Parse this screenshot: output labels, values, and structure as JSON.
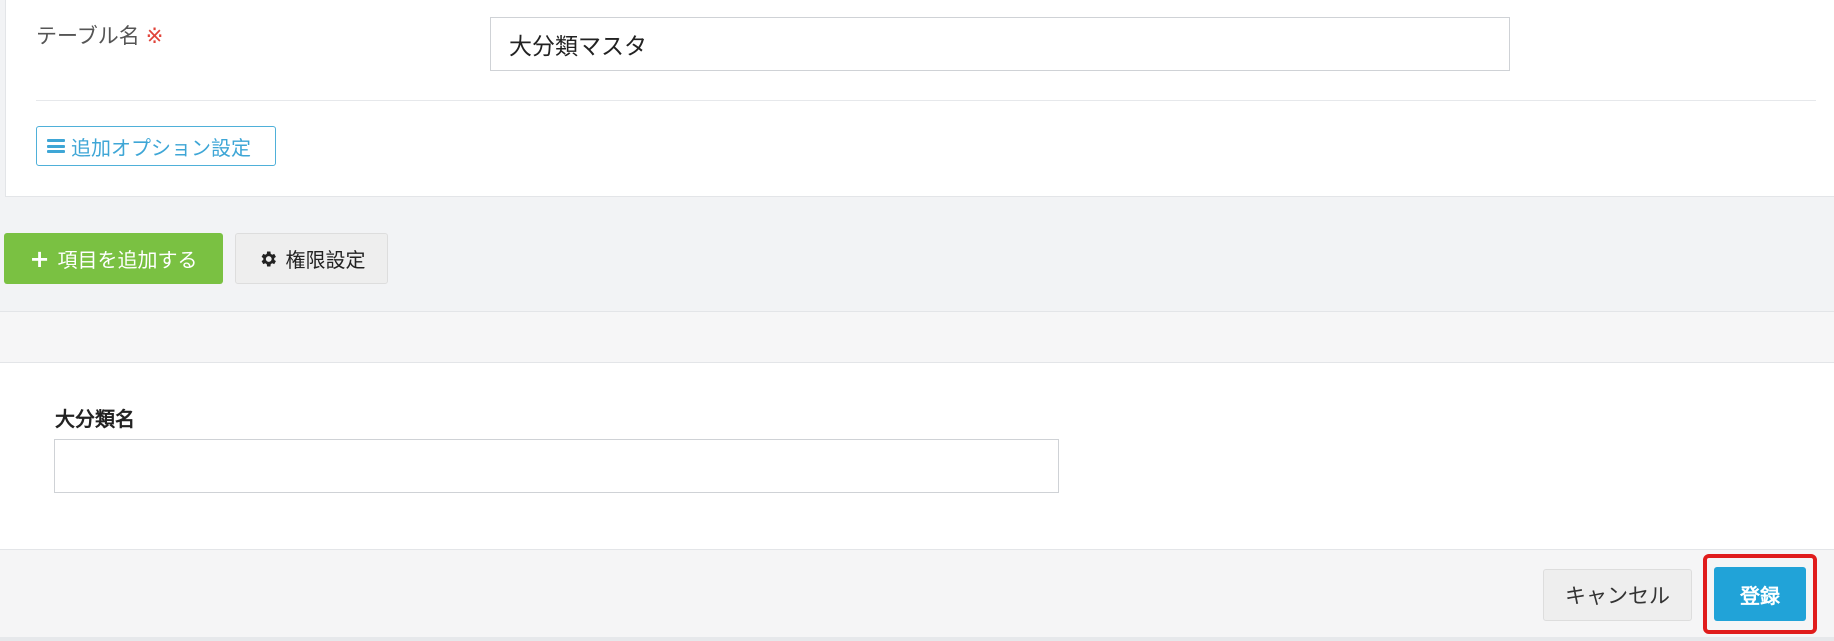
{
  "table_section": {
    "label": "テーブル名",
    "required_mark": "※",
    "table_name_value": "大分類マスタ",
    "option_button_label": "追加オプション設定",
    "option_icon": "bars-icon"
  },
  "toolbar": {
    "add_item_label": "項目を追加する",
    "add_item_icon": "plus-icon",
    "permission_label": "権限設定",
    "permission_icon": "gear-icon"
  },
  "form": {
    "field_label": "大分類名",
    "field_value": ""
  },
  "footer": {
    "cancel_label": "キャンセル",
    "register_label": "登録"
  },
  "colors": {
    "accent_green": "#7ac142",
    "accent_blue": "#21a3d8",
    "link_blue": "#3ea6d6",
    "required_red": "#e0443a",
    "highlight_red": "#e01c1c"
  }
}
